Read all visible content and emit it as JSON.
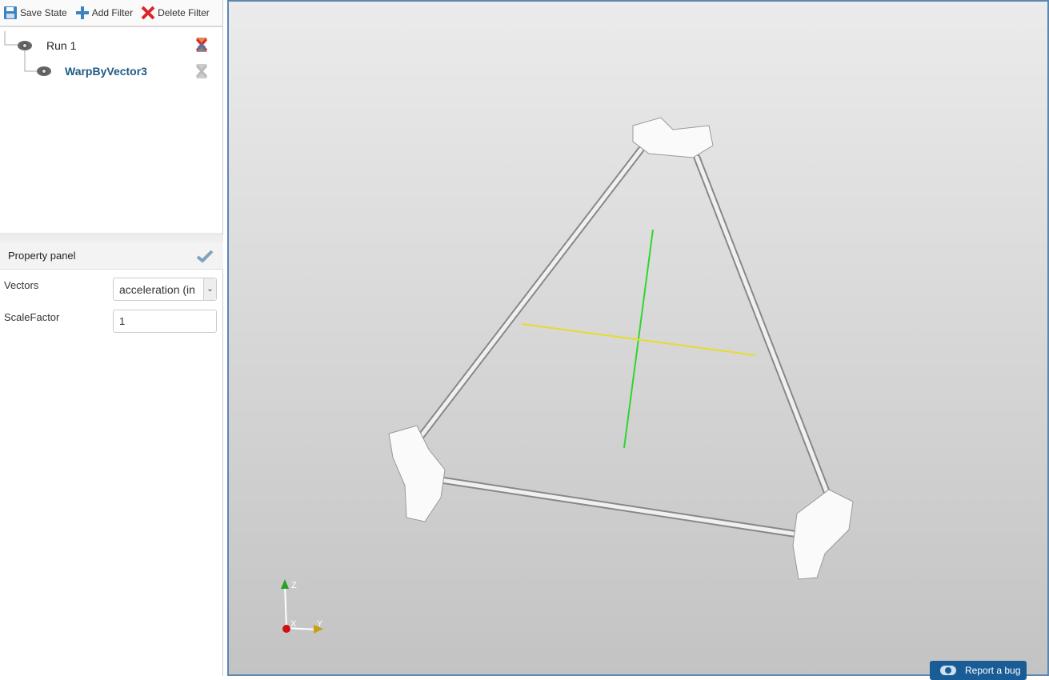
{
  "toolbar": {
    "save_state": "Save State",
    "add_filter": "Add Filter",
    "delete_filter": "Delete Filter"
  },
  "pipeline": [
    {
      "label": "Run 1"
    },
    {
      "label": "WarpByVector3"
    }
  ],
  "property_panel": {
    "title": "Property panel",
    "vectors_label": "Vectors",
    "vectors_value": "acceleration (in",
    "scale_label": "ScaleFactor",
    "scale_value": "1"
  },
  "axes": {
    "z": "Z",
    "x": "X",
    "y": "Y"
  },
  "report_bug": "Report a bug",
  "colors": {
    "accent": "#1a5d96",
    "title_blue": "#1f5a85",
    "delete_red": "#d9262c"
  }
}
